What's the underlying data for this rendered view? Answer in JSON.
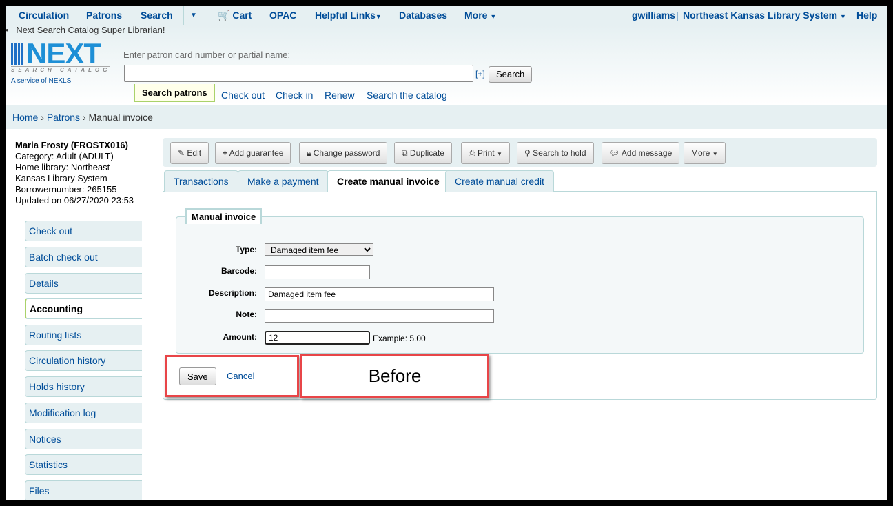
{
  "nav": {
    "items": [
      "Circulation",
      "Patrons",
      "Search",
      "Cart",
      "OPAC",
      "Helpful Links",
      "Databases",
      "More"
    ],
    "user": "gwilliams",
    "library": "Northeast Kansas Library System",
    "help": "Help"
  },
  "banner": "Next Search Catalog Super Librarian!",
  "logo": {
    "text": "NEXT",
    "sub": "SEARCH CATALOG",
    "service": "A service of NEKLS"
  },
  "search": {
    "label": "Enter patron card number or partial name:",
    "value": "",
    "expand": "[+]",
    "button": "Search",
    "tabs": [
      "Search patrons",
      "Check out",
      "Check in",
      "Renew",
      "Search the catalog"
    ]
  },
  "breadcrumb": [
    "Home",
    "Patrons",
    "Manual invoice"
  ],
  "patron": {
    "name": "Maria Frosty (FROSTX016)",
    "category": "Category: Adult (ADULT)",
    "library": "Home library: Northeast Kansas Library System",
    "borrower": "Borrowernumber: 265155",
    "updated": "Updated on 06/27/2020 23:53"
  },
  "sidebar": [
    "Check out",
    "Batch check out",
    "Details",
    "Accounting",
    "Routing lists",
    "Circulation history",
    "Holds history",
    "Modification log",
    "Notices",
    "Statistics",
    "Files"
  ],
  "toolbar": [
    "Edit",
    "Add guarantee",
    "Change password",
    "Duplicate",
    "Print",
    "Search to hold",
    "Add message",
    "More"
  ],
  "tabs": [
    "Transactions",
    "Make a payment",
    "Create manual invoice",
    "Create manual credit"
  ],
  "form": {
    "legend": "Manual invoice",
    "type_label": "Type:",
    "type_value": "Damaged item fee",
    "barcode_label": "Barcode:",
    "barcode_value": "",
    "desc_label": "Description:",
    "desc_value": "Damaged item fee",
    "note_label": "Note:",
    "note_value": "",
    "amount_label": "Amount:",
    "amount_value": "12",
    "example": "Example: 5.00",
    "save": "Save",
    "cancel": "Cancel"
  },
  "annotation": "Before"
}
